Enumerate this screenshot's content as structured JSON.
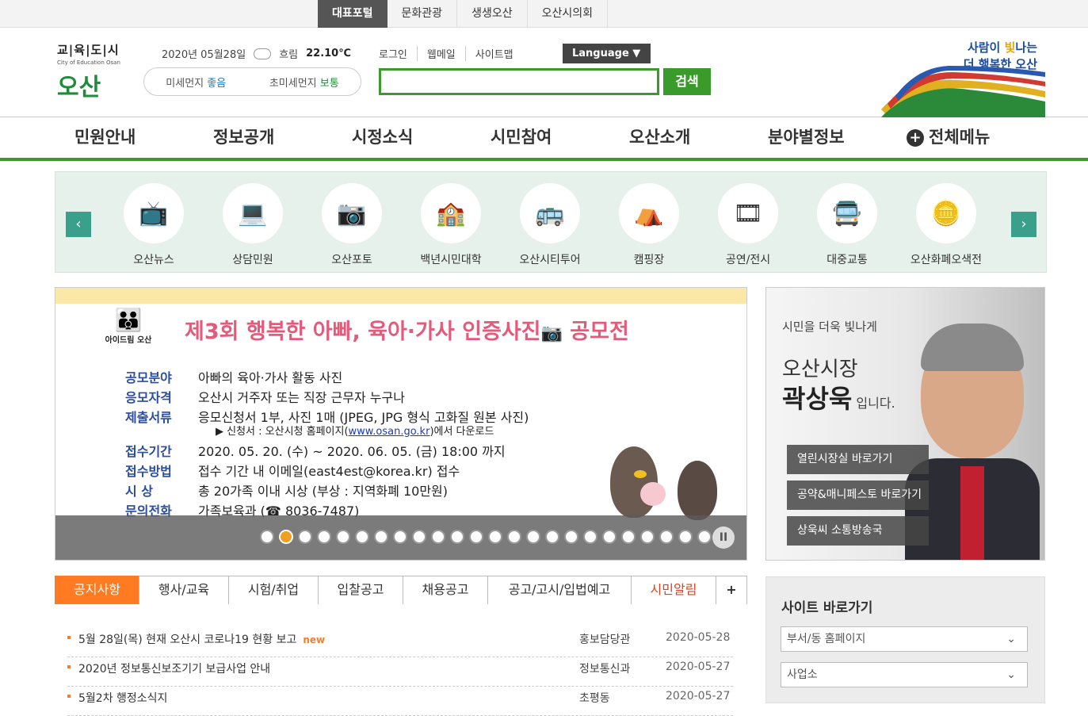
{
  "top_tabs": [
    "대표포털",
    "문화관광",
    "생생오산",
    "오산시의회"
  ],
  "logo": {
    "top": "교|육|도|시",
    "sub": "City of Education Osan",
    "name": "오산"
  },
  "weather": {
    "date": "2020년 05월28일",
    "condition": "흐림",
    "temp": "22.10℃"
  },
  "dust": {
    "fine_label": "미세먼지",
    "fine_value": "좋음",
    "ultra_label": "초미세먼지",
    "ultra_value": "보통"
  },
  "links": [
    "로그인",
    "웹메일",
    "사이트맵"
  ],
  "language": "Language ▼",
  "search": {
    "button": "검색",
    "placeholder": ""
  },
  "slogan": {
    "line1a": "사람이 ",
    "line1b": "빛",
    "line1c": "나는",
    "line2": "더 행복한 오산"
  },
  "gnb": [
    "민원안내",
    "정보공개",
    "시정소식",
    "시민참여",
    "오산소개",
    "분야별정보"
  ],
  "all_menu": "전체메뉴",
  "quick": {
    "items": [
      {
        "label": "오산뉴스",
        "icon": "📺"
      },
      {
        "label": "상담민원",
        "icon": "💻"
      },
      {
        "label": "오산포토",
        "icon": "📷"
      },
      {
        "label": "백년시민대학",
        "icon": "🏫"
      },
      {
        "label": "오산시티투어",
        "icon": "🚌"
      },
      {
        "label": "캠핑장",
        "icon": "⛺"
      },
      {
        "label": "공연/전시",
        "icon": "🎞"
      },
      {
        "label": "대중교통",
        "icon": "🚍"
      },
      {
        "label": "오산화폐오색전",
        "icon": "🪙"
      }
    ],
    "prev": "‹",
    "next": "›"
  },
  "banner": {
    "logo_label": "아이드림 오산",
    "title_a": "제3회 행복한 아빠, 육아·가사 인증사진",
    "title_b": " 공모전",
    "rows": [
      {
        "k": "공모분야",
        "v": "아빠의 육아·가사 활동 사진"
      },
      {
        "k": "응모자격",
        "v": "오산시 거주자 또는 직장 근무자 누구나"
      },
      {
        "k": "제출서류",
        "v": "응모신청서 1부, 사진 1매 (JPEG, JPG 형식 고화질 원본 사진)"
      },
      {
        "k": "접수기간",
        "v": "2020. 05. 20. (수) ~ 2020. 06. 05. (금) 18:00 까지"
      },
      {
        "k": "접수방법",
        "v": "접수 기간 내 이메일(east4est@korea.kr) 접수"
      },
      {
        "k": "시 상",
        "v": "총 20가족 이내 시상 (부상 : 지역화폐 10만원)"
      },
      {
        "k": "문의전화",
        "v": "가족보육과 (☎ 8036-7487)"
      }
    ],
    "note_a": "▶ 신청서 : 오산시청 홈페이지(",
    "note_link": "www.osan.go.kr",
    "note_b": ")에서 다운로드",
    "dot_count": 24,
    "active_dot": 2,
    "pause": "II"
  },
  "mayor": {
    "line1": "시민을 더욱 빛나게",
    "line2": "오산시장",
    "name": "곽상욱",
    "suffix": " 입니다.",
    "buttons": [
      "열린시장실 바로가기",
      "공약&매니페스토 바로가기",
      "상욱씨 소통방송국"
    ]
  },
  "tabs": [
    "공지사항",
    "행사/교육",
    "시험/취업",
    "입찰공고",
    "채용공고",
    "공고/고시/입법예고",
    "시민알림",
    "+"
  ],
  "notices": [
    {
      "title": "5월 28일(목) 현재 오산시 코로나19 현황 보고",
      "new": "new",
      "dept": "홍보담당관",
      "date": "2020-05-28"
    },
    {
      "title": "2020년 정보통신보조기기 보급사업 안내",
      "new": "",
      "dept": "정보통신과",
      "date": "2020-05-27"
    },
    {
      "title": "5월2차 행정소식지",
      "new": "",
      "dept": "초평동",
      "date": "2020-05-27"
    }
  ],
  "site_links": {
    "heading": "사이트 바로가기",
    "selects": [
      "부서/동 홈페이지",
      "사업소"
    ]
  },
  "colors": {
    "green": "#3a9a2a",
    "orange": "#ff7a21",
    "teal": "#3aa08c"
  }
}
